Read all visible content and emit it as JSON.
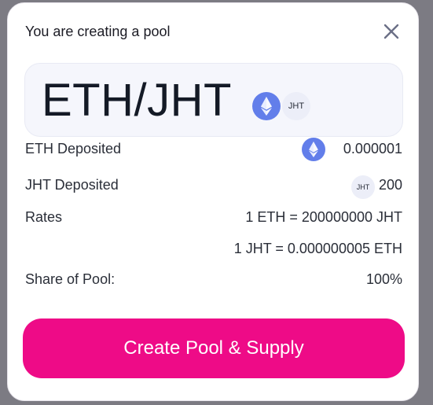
{
  "header": {
    "title": "You are creating a pool",
    "close_icon": "close-icon"
  },
  "pair": {
    "name": "ETH/JHT",
    "token_a_icon": "eth-icon",
    "token_b_label": "JHT"
  },
  "deposits": {
    "eth_label": "ETH Deposited",
    "eth_value": "0.000001",
    "eth_icon": "eth-icon",
    "jht_label": "JHT Deposited",
    "jht_value": "200",
    "jht_icon_label": "JHT"
  },
  "rates": {
    "label": "Rates",
    "rate_1": "1 ETH = 200000000 JHT",
    "rate_2": "1 JHT = 0.000000005 ETH"
  },
  "share": {
    "label": "Share of Pool:",
    "value": "100%"
  },
  "cta": {
    "label": "Create Pool & Supply"
  },
  "colors": {
    "accent": "#ee0b87",
    "eth_blue": "#627eea",
    "panel_bg": "#f5f6fc"
  }
}
